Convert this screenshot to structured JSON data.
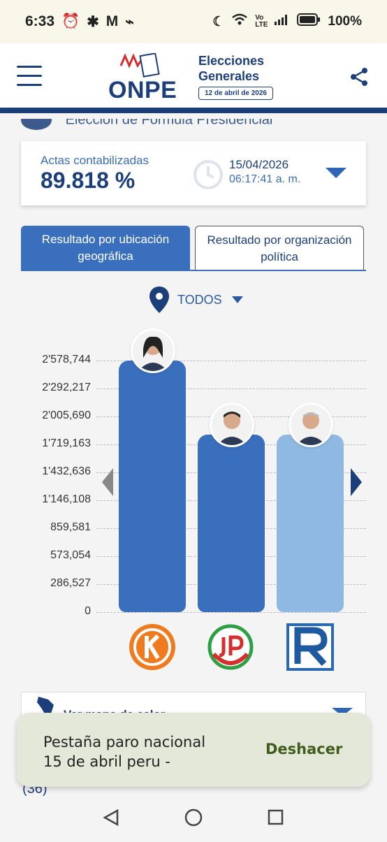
{
  "status_bar": {
    "time": "6:33",
    "battery": "100%"
  },
  "header": {
    "logo_text": "ONPE",
    "title_line1": "Elecciones",
    "title_line2": "Generales",
    "date": "12 de abril de 2026"
  },
  "subheader": {
    "text": "Elección de Fórmula Presidencial"
  },
  "actas": {
    "label": "Actas contabilizadas",
    "value": "89.818 %",
    "date": "15/04/2026",
    "time": "06:17:41 a. m."
  },
  "tabs": [
    {
      "label": "Resultado por ubicación geográfica",
      "active": true
    },
    {
      "label": "Resultado por organización política",
      "active": false
    }
  ],
  "filter": {
    "label": "TODOS"
  },
  "chart_data": {
    "type": "bar",
    "y_ticks": [
      "2'578,744",
      "2'292,217",
      "2'005,690",
      "1'719,163",
      "1'432,636",
      "1'146,108",
      "859,581",
      "573,054",
      "286,527",
      "0"
    ],
    "ylim": [
      0,
      2578744
    ],
    "values": [
      2578744,
      1820000,
      1820000
    ],
    "colors": [
      "#3a6fbd",
      "#3a6fbd",
      "#8fb9e2"
    ],
    "grid": true
  },
  "map_bar": {
    "text": "Ver mapa de calor"
  },
  "snackbar": {
    "message": "Pestaña paro nacional\n15 de abril peru -",
    "action": "Deshacer"
  },
  "under_snack": {
    "text": "(36)"
  }
}
